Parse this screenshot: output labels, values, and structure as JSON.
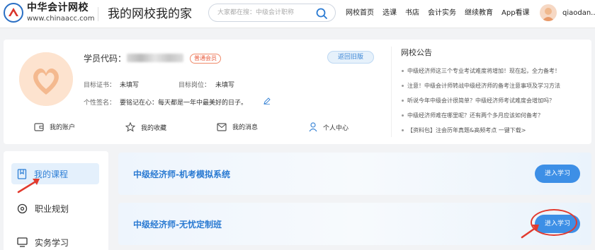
{
  "header": {
    "logo_cn": "中华会计网校",
    "logo_en": "www.chinaacc.com",
    "slogan": "我的网校我的家",
    "search_placeholder": "大家都在搜：中级会计职称",
    "nav": [
      "网校首页",
      "选课",
      "书店",
      "会计实务",
      "继续教育",
      "App看课"
    ],
    "username": "qiaodan..."
  },
  "profile": {
    "student_code_label": "学员代码：",
    "member_badge": "普通会员",
    "old_version_button": "返回旧版",
    "target_cert_label": "目标证书：",
    "target_cert_value": "未填写",
    "target_post_label": "目标岗位：",
    "target_post_value": "未填写",
    "signature_label": "个性签名：",
    "signature_value": "要铭记在心：每天都是一年中最美好的日子。",
    "quick_links": [
      "我的账户",
      "我的收藏",
      "我的消息",
      "个人中心"
    ]
  },
  "notice": {
    "title": "网校公告",
    "items": [
      "中级经济师这三个专业考试难度将增加！现在起，全力备考！",
      "注意！中级会计师转战中级经济师的备考注意事项及学习方法",
      "听说今年中级会计很简单？中级经济师考试难度会增加吗？",
      "中级经济师难在哪里呢？还有两个多月应该如何备考？",
      "【资料包】注会历年真题&高频考点 一键下载>"
    ]
  },
  "sidebar": {
    "items": [
      "我的课程",
      "职业规划",
      "实务学习"
    ]
  },
  "courses": [
    {
      "name": "中级经济师-机考模拟系统",
      "button": "进入学习"
    },
    {
      "name": "中级经济师-无忧定制班",
      "button": "进入学习"
    }
  ],
  "colors": {
    "accent": "#3d8fe6",
    "course_title": "#2a7ad2",
    "annotation_red": "#e23a2e"
  }
}
